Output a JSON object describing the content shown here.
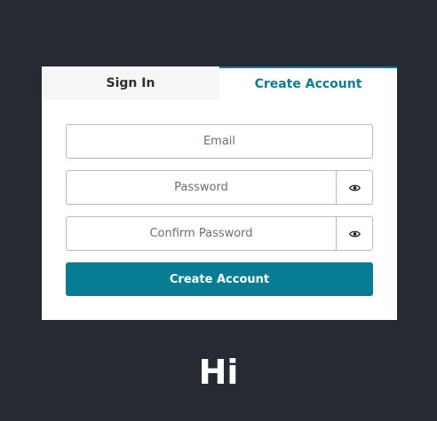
{
  "tabs": {
    "sign_in": "Sign In",
    "create_account": "Create Account"
  },
  "form": {
    "email_placeholder": "Email",
    "password_placeholder": "Password",
    "confirm_password_placeholder": "Confirm Password",
    "submit_label": "Create Account"
  },
  "icons": {
    "password_toggle": "eye-icon",
    "confirm_password_toggle": "eye-icon"
  },
  "greeting": "Hi",
  "colors": {
    "background": "#262a33",
    "accent": "#087c93",
    "tab_active_text": "#0d7b91"
  }
}
